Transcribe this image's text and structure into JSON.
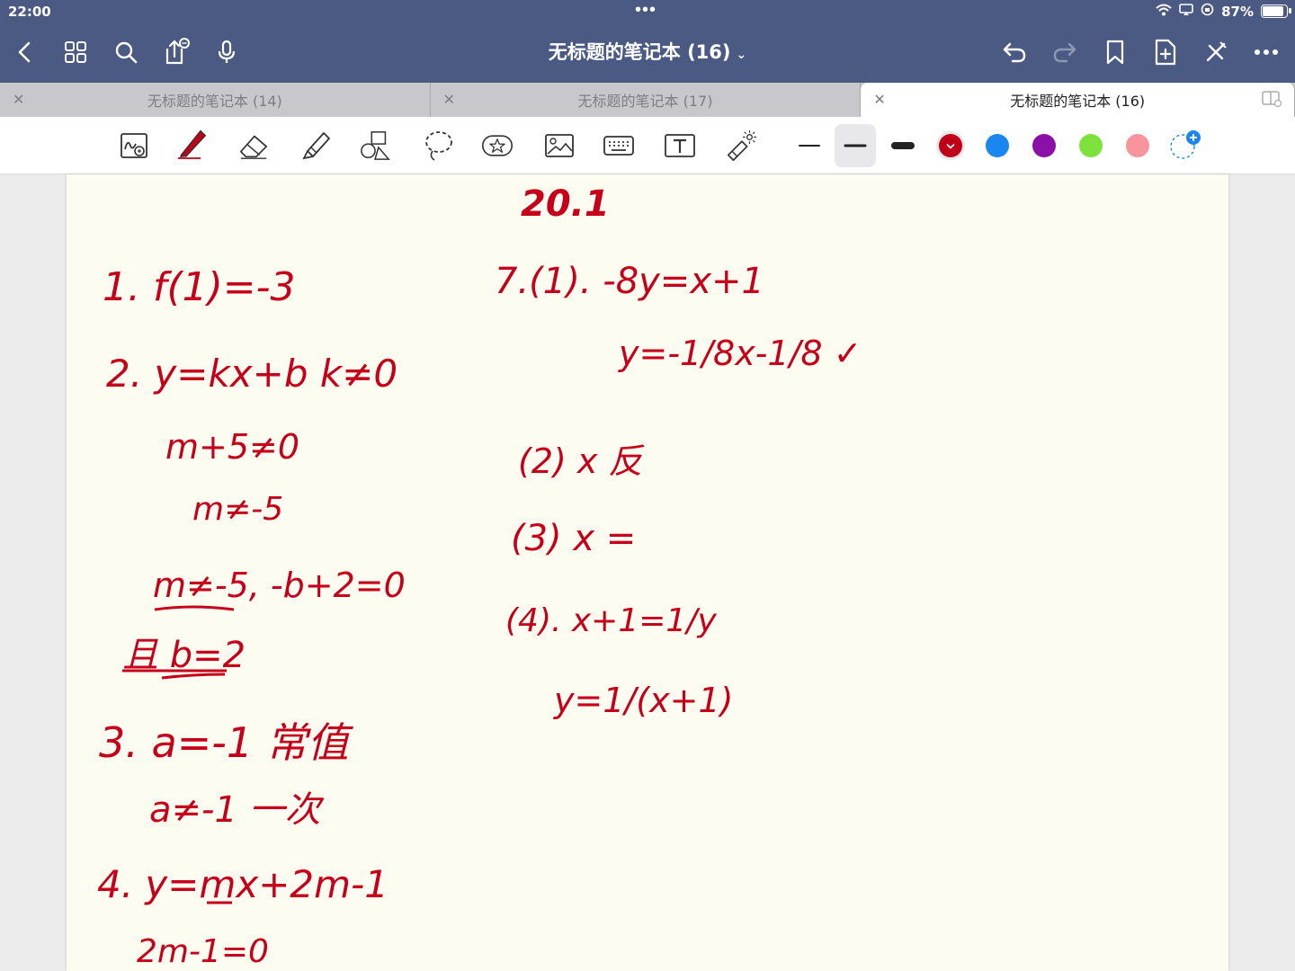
{
  "status_bar": {
    "time": "22:00",
    "dots": "•••",
    "battery_text": "87%",
    "battery_level": 0.87
  },
  "header": {
    "title": "无标题的笔记本 (16)",
    "title_chevron": "⌄"
  },
  "tabs": [
    {
      "label": "无标题的笔记本 (14)",
      "active": false
    },
    {
      "label": "无标题的笔记本 (17)",
      "active": false
    },
    {
      "label": "无标题的笔记本 (16)",
      "active": true
    }
  ],
  "toolbar": {
    "tools": [
      "zoom-handwriting-icon",
      "pen-icon",
      "eraser-icon",
      "highlighter-icon",
      "shapes-icon",
      "lasso-icon",
      "sticker-icon",
      "image-icon",
      "keyboard-icon",
      "text-box-icon",
      "laser-pointer-icon"
    ],
    "colors": [
      "#c00018",
      "#1a86f0",
      "#8b10a8",
      "#7ee23c",
      "#f7949c"
    ]
  },
  "notes": [
    {
      "text": "20.1"
    },
    {
      "text": "1. f(1)=-3"
    },
    {
      "text": "2. y=kx+b k≠0"
    },
    {
      "text": "m+5≠0"
    },
    {
      "text": "m≠-5"
    },
    {
      "text": "m≠-5, -b+2=0"
    },
    {
      "text": "且 b=2"
    },
    {
      "text": "3. a=-1 常值"
    },
    {
      "text": "a≠-1 一次"
    },
    {
      "text": "4. y=mx+2m-1"
    },
    {
      "text": "2m-1=0"
    },
    {
      "text": "7.(1). -8y=x+1"
    },
    {
      "text": "y=-1/8x-1/8 ✓"
    },
    {
      "text": "(2) x 反"
    },
    {
      "text": "(3) x ="
    },
    {
      "text": "(4). x+1=1/y"
    },
    {
      "text": "y=1/(x+1)"
    }
  ]
}
